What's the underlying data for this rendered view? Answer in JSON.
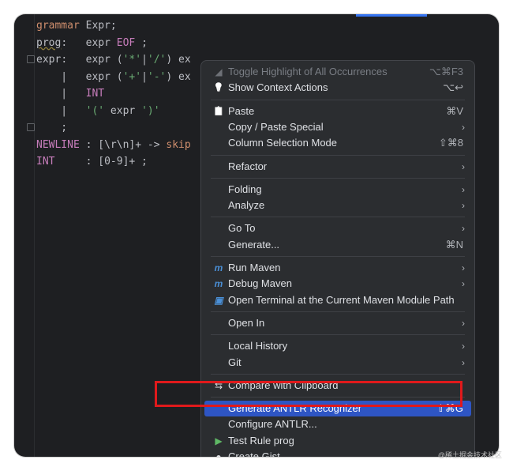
{
  "editor": {
    "lines": [
      [
        {
          "t": "grammar",
          "c": "kw"
        },
        {
          "t": " Expr;",
          "c": "id"
        }
      ],
      [
        {
          "t": "prog",
          "c": "id ul"
        },
        {
          "t": ":   expr ",
          "c": "id"
        },
        {
          "t": "EOF",
          "c": "tok"
        },
        {
          "t": " ;",
          "c": "id"
        }
      ],
      [
        {
          "t": "expr",
          "c": "id"
        },
        {
          "t": ":   expr (",
          "c": "id"
        },
        {
          "t": "'*'",
          "c": "str"
        },
        {
          "t": "|",
          "c": "id"
        },
        {
          "t": "'/'",
          "c": "str"
        },
        {
          "t": ") ex",
          "c": "id"
        }
      ],
      [
        {
          "t": "    |   expr (",
          "c": "id"
        },
        {
          "t": "'+'",
          "c": "str"
        },
        {
          "t": "|",
          "c": "id"
        },
        {
          "t": "'-'",
          "c": "str"
        },
        {
          "t": ") ex",
          "c": "id"
        }
      ],
      [
        {
          "t": "    |   ",
          "c": "id"
        },
        {
          "t": "INT",
          "c": "tok"
        }
      ],
      [
        {
          "t": "    |   ",
          "c": "id"
        },
        {
          "t": "'('",
          "c": "str"
        },
        {
          "t": " expr ",
          "c": "id"
        },
        {
          "t": "')'",
          "c": "str"
        }
      ],
      [
        {
          "t": "    ;",
          "c": "id"
        }
      ],
      [
        {
          "t": "NEWLINE",
          "c": "tok"
        },
        {
          "t": " : [\\r\\n]+ -> ",
          "c": "id"
        },
        {
          "t": "skip",
          "c": "kw"
        }
      ],
      [
        {
          "t": "INT",
          "c": "tok"
        },
        {
          "t": "     : [0-9]+ ;",
          "c": "id"
        }
      ]
    ]
  },
  "menu": {
    "items": [
      {
        "label": "Toggle Highlight of All Occurrences",
        "shortcut": "⌥⌘F3",
        "icon": "highlight-icon",
        "glyph": "◢",
        "disabled": true
      },
      {
        "label": "Show Context Actions",
        "shortcut": "⌥↩",
        "icon": "bulb-icon",
        "glyph": "💡"
      },
      {
        "sep": true
      },
      {
        "label": "Paste",
        "shortcut": "⌘V",
        "icon": "clipboard-icon",
        "glyph": "📋"
      },
      {
        "label": "Copy / Paste Special",
        "arrow": true
      },
      {
        "label": "Column Selection Mode",
        "shortcut": "⇧⌘8"
      },
      {
        "sep": true
      },
      {
        "label": "Refactor",
        "arrow": true
      },
      {
        "sep": true
      },
      {
        "label": "Folding",
        "arrow": true
      },
      {
        "label": "Analyze",
        "arrow": true
      },
      {
        "sep": true
      },
      {
        "label": "Go To",
        "arrow": true
      },
      {
        "label": "Generate...",
        "shortcut": "⌘N"
      },
      {
        "sep": true
      },
      {
        "label": "Run Maven",
        "arrow": true,
        "icon": "maven-icon",
        "glyph": "m"
      },
      {
        "label": "Debug Maven",
        "arrow": true,
        "icon": "maven-debug-icon",
        "glyph": "m"
      },
      {
        "label": "Open Terminal at the Current Maven Module Path",
        "icon": "maven-terminal-icon",
        "glyph": "▣"
      },
      {
        "sep": true
      },
      {
        "label": "Open In",
        "arrow": true
      },
      {
        "sep": true
      },
      {
        "label": "Local History",
        "arrow": true
      },
      {
        "label": "Git",
        "arrow": true
      },
      {
        "sep": true
      },
      {
        "label": "Compare with Clipboard",
        "icon": "compare-icon",
        "glyph": "⇆"
      },
      {
        "sep": true
      },
      {
        "label": "Generate ANTLR Recognizer",
        "shortcut": "⇧⌘G",
        "selected": true
      },
      {
        "label": "Configure ANTLR..."
      },
      {
        "label": "Test Rule prog",
        "icon": "run-icon",
        "glyph": "▶"
      },
      {
        "label": "Create Gist...",
        "icon": "github-icon",
        "glyph": "●"
      }
    ]
  },
  "watermark": "@稀土掘金技术社区",
  "colors": {
    "selection": "#2e55c4",
    "highlight_border": "#e0191b",
    "run_icon": "#5fb865",
    "maven_icon": "#4a8fd6"
  }
}
